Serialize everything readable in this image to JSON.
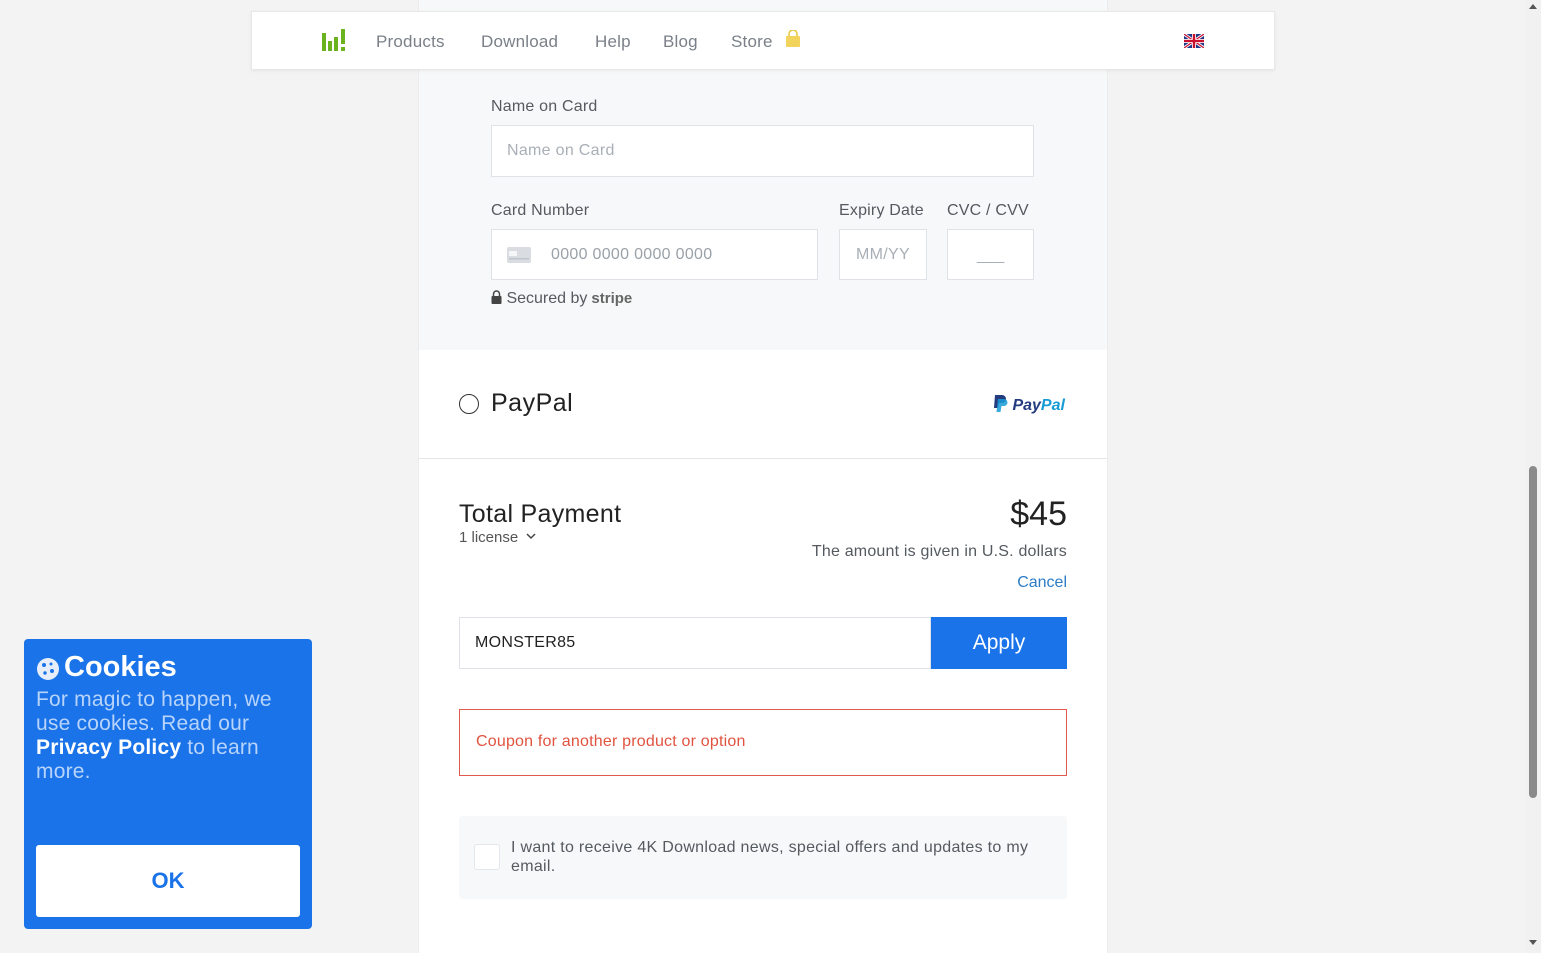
{
  "nav": {
    "items": [
      {
        "label": "Products"
      },
      {
        "label": "Download"
      },
      {
        "label": "Help"
      },
      {
        "label": "Blog"
      },
      {
        "label": "Store"
      }
    ],
    "logo_icon": "4k-download-logo",
    "store_icon": "shopping-bag-icon",
    "language_icon": "uk-flag-icon"
  },
  "card_form": {
    "name_label": "Name on Card",
    "name_placeholder": "Name on Card",
    "number_label": "Card Number",
    "number_placeholder": "0000 0000 0000 0000",
    "expiry_label": "Expiry Date",
    "expiry_placeholder": "MM/YY",
    "cvc_label": "CVC / CVV",
    "cvc_placeholder": "___",
    "secured_text": "Secured by",
    "secured_brand": "stripe"
  },
  "paypal": {
    "label": "PayPal",
    "logo_text_pay": "Pay",
    "logo_text_pal": "Pal"
  },
  "total": {
    "title": "Total Payment",
    "license": "1 license",
    "price": "$45",
    "currency_note": "The amount is given in U.S. dollars",
    "cancel": "Cancel"
  },
  "coupon": {
    "value": "MONSTER85",
    "apply_label": "Apply",
    "error": "Coupon for another product or option"
  },
  "newsletter": {
    "text": "I want to receive 4K Download news, special offers and updates to my email."
  },
  "cookies": {
    "title": "Cookies",
    "text_before": "For magic to happen, we use cookies. Read our ",
    "link": "Privacy Policy",
    "text_after": " to learn more.",
    "ok_label": "OK"
  },
  "colors": {
    "accent": "#1a73e8",
    "error": "#e0533f",
    "logo_green": "#6ab31e",
    "link": "#2c7cc6"
  }
}
